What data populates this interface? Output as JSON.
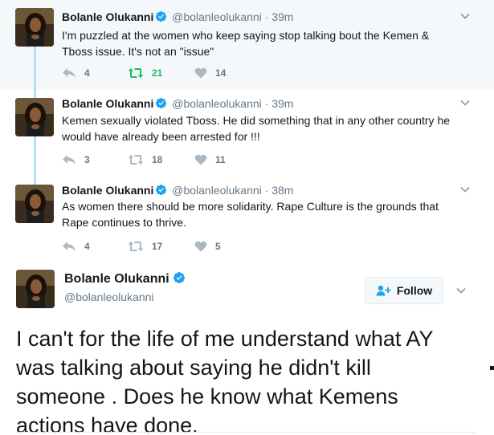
{
  "thread": [
    {
      "name": "Bolanle Olukanni",
      "handle": "@bolanleolukanni",
      "separator": "·",
      "time": "39m",
      "text_lines": [
        "I'm puzzled at the women who keep saying stop talking bout the Kemen &",
        "Tboss issue. It's not an \"issue\""
      ],
      "replies": "4",
      "retweets": "21",
      "likes": "14",
      "retweeted": true
    },
    {
      "name": "Bolanle Olukanni",
      "handle": "@bolanleolukanni",
      "separator": "·",
      "time": "39m",
      "text_lines": [
        "Kemen sexually violated Tboss. He did something that in any other country he",
        "would have already been arrested for !!!"
      ],
      "replies": "3",
      "retweets": "18",
      "likes": "11",
      "retweeted": false
    },
    {
      "name": "Bolanle Olukanni",
      "handle": "@bolanleolukanni",
      "separator": "·",
      "time": "38m",
      "text_lines": [
        "As women there should be more solidarity. Rape Culture is the grounds that",
        "Rape continues to thrive."
      ],
      "replies": "4",
      "retweets": "17",
      "likes": "5",
      "retweeted": false
    }
  ],
  "main_tweet": {
    "name": "Bolanle Olukanni",
    "handle": "@bolanleolukanni",
    "follow_label": "Follow",
    "text_lines": [
      "I can't for the life of me understand what AY",
      "was talking about saying he didn't kill",
      "someone . Does he know what Kemens",
      "actions have done."
    ]
  },
  "icons": {
    "verified": "verified-badge-icon",
    "reply": "reply-icon",
    "retweet": "retweet-icon",
    "like": "heart-icon",
    "caret": "chevron-down-icon",
    "follow": "follow-person-icon"
  },
  "colors": {
    "verified_blue": "#1da1f2",
    "retweet_green": "#17bf63",
    "thread_line": "#b3e0f7",
    "muted_text": "#657786",
    "highlight_bg": "#f5f8fa"
  }
}
